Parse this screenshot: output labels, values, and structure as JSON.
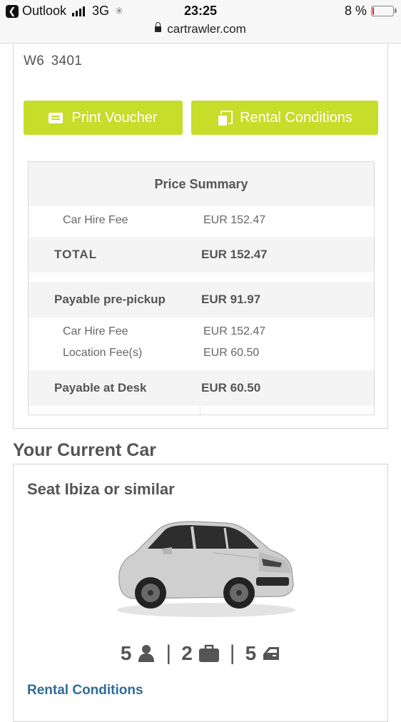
{
  "status_bar": {
    "back_app": "Outlook",
    "network": "3G",
    "time": "23:25",
    "battery": "8 %",
    "battery_level": 0.08,
    "url": "cartrawler.com"
  },
  "booking": {
    "reference": "W6  3401",
    "buttons": {
      "print_voucher": "Print Voucher",
      "rental_conditions": "Rental Conditions"
    },
    "accent_color": "#c6dd2a",
    "price_summary": {
      "title": "Price Summary",
      "car_hire_fee": {
        "label": "Car Hire Fee",
        "value": "EUR 152.47"
      },
      "total": {
        "label": "TOTAL",
        "value": "EUR 152.47"
      },
      "payable_pre_pickup": {
        "label": "Payable pre-pickup",
        "value": "EUR 91.97"
      },
      "pre_pickup_items": [
        {
          "label": "Car Hire Fee",
          "value": "EUR 152.47"
        },
        {
          "label": "Location Fee(s)",
          "value": "EUR 60.50"
        }
      ],
      "payable_at_desk": {
        "label": "Payable at Desk",
        "value": "EUR 60.50"
      }
    }
  },
  "current_car": {
    "section_title": "Your Current Car",
    "name": "Seat Ibiza or similar",
    "specs": {
      "passengers": "5",
      "bags": "2",
      "doors": "5"
    },
    "rental_conditions_link": "Rental Conditions",
    "link_color": "#2f6c97"
  }
}
